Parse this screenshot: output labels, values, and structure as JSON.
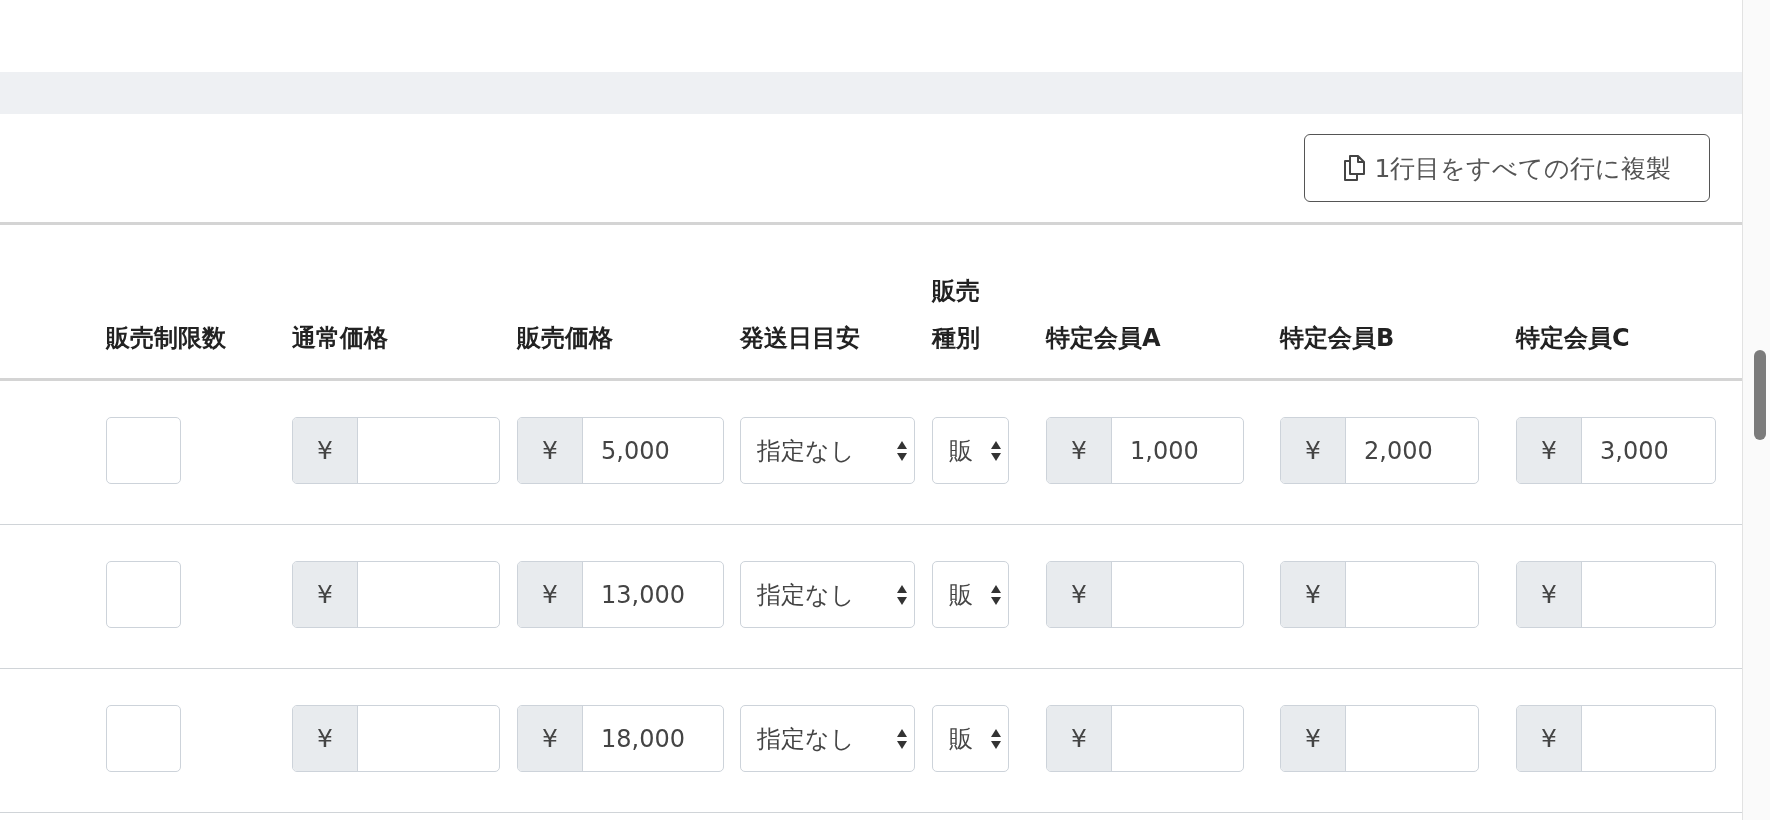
{
  "copy_button": {
    "label": "1行目をすべての行に複製"
  },
  "columns": [
    {
      "label": "販売制限数"
    },
    {
      "label": "通常価格"
    },
    {
      "label": "販売価格"
    },
    {
      "label": "発送日目安"
    },
    {
      "label": "販売種別"
    },
    {
      "label": "特定会員A"
    },
    {
      "label": "特定会員B"
    },
    {
      "label": "特定会員C"
    }
  ],
  "rows": [
    {
      "cells": [
        {
          "kind": "input"
        },
        {
          "kind": "yen",
          "addon": "¥"
        },
        {
          "kind": "yen",
          "addon": "¥",
          "value": "5,000"
        },
        {
          "kind": "select",
          "value": "指定なし"
        },
        {
          "kind": "select",
          "value": "販"
        },
        {
          "kind": "yen",
          "addon": "¥",
          "value": "1,000"
        },
        {
          "kind": "yen",
          "addon": "¥",
          "value": "2,000"
        },
        {
          "kind": "yen",
          "addon": "¥",
          "value": "3,000"
        }
      ]
    },
    {
      "cells": [
        {
          "kind": "input"
        },
        {
          "kind": "yen",
          "addon": "¥"
        },
        {
          "kind": "yen",
          "addon": "¥",
          "value": "13,000"
        },
        {
          "kind": "select",
          "value": "指定なし"
        },
        {
          "kind": "select",
          "value": "販"
        },
        {
          "kind": "yen",
          "addon": "¥"
        },
        {
          "kind": "yen",
          "addon": "¥"
        },
        {
          "kind": "yen",
          "addon": "¥"
        }
      ]
    },
    {
      "cells": [
        {
          "kind": "input"
        },
        {
          "kind": "yen",
          "addon": "¥"
        },
        {
          "kind": "yen",
          "addon": "¥",
          "value": "18,000"
        },
        {
          "kind": "select",
          "value": "指定なし"
        },
        {
          "kind": "select",
          "value": "販"
        },
        {
          "kind": "yen",
          "addon": "¥"
        },
        {
          "kind": "yen",
          "addon": "¥"
        },
        {
          "kind": "yen",
          "addon": "¥"
        }
      ]
    }
  ]
}
